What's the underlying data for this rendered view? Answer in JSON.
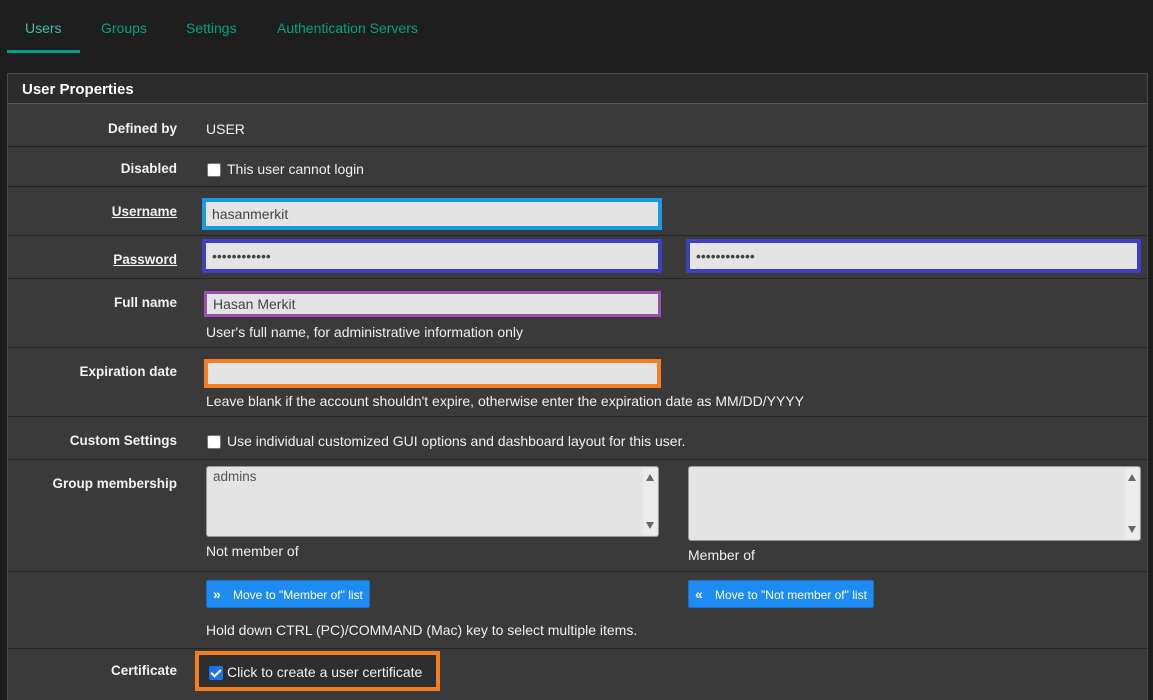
{
  "tabs": [
    "Users",
    "Groups",
    "Settings",
    "Authentication Servers"
  ],
  "panel": {
    "title": "User Properties"
  },
  "defined_by": {
    "label": "Defined by",
    "value": "USER"
  },
  "disabled": {
    "label": "Disabled",
    "checkbox_label": "This user cannot login",
    "checked": false
  },
  "username": {
    "label": "Username",
    "value": "hasanmerkit"
  },
  "password": {
    "label": "Password",
    "value": "••••••••••••",
    "confirm_value": "••••••••••••"
  },
  "full_name": {
    "label": "Full name",
    "value": "Hasan Merkit",
    "help": "User's full name, for administrative information only"
  },
  "expiration": {
    "label": "Expiration date",
    "value": "",
    "help": "Leave blank if the account shouldn't expire, otherwise enter the expiration date as MM/DD/YYYY"
  },
  "custom_settings": {
    "label": "Custom Settings",
    "checkbox_label": "Use individual customized GUI options and dashboard layout for this user.",
    "checked": false
  },
  "group_membership": {
    "label": "Group membership",
    "not_member_options": [
      "admins"
    ],
    "not_member_caption": "Not member of",
    "member_options": [],
    "member_caption": "Member of"
  },
  "move_buttons": {
    "to_member": "Move to \"Member of\" list",
    "to_not_member": "Move to \"Not member of\" list",
    "help": "Hold down CTRL (PC)/COMMAND (Mac) key to select multiple items."
  },
  "certificate": {
    "label": "Certificate",
    "checkbox_label": "Click to create a user certificate",
    "checked": true
  },
  "colors": {
    "accent": "#00a389",
    "username_highlight": "#1a9be0",
    "password_highlight": "#3f3fc4",
    "fullname_highlight": "#9b4fb0",
    "expiration_highlight": "#f57f20",
    "certificate_highlight": "#f57f20",
    "button_blue": "#1d8bf1"
  }
}
